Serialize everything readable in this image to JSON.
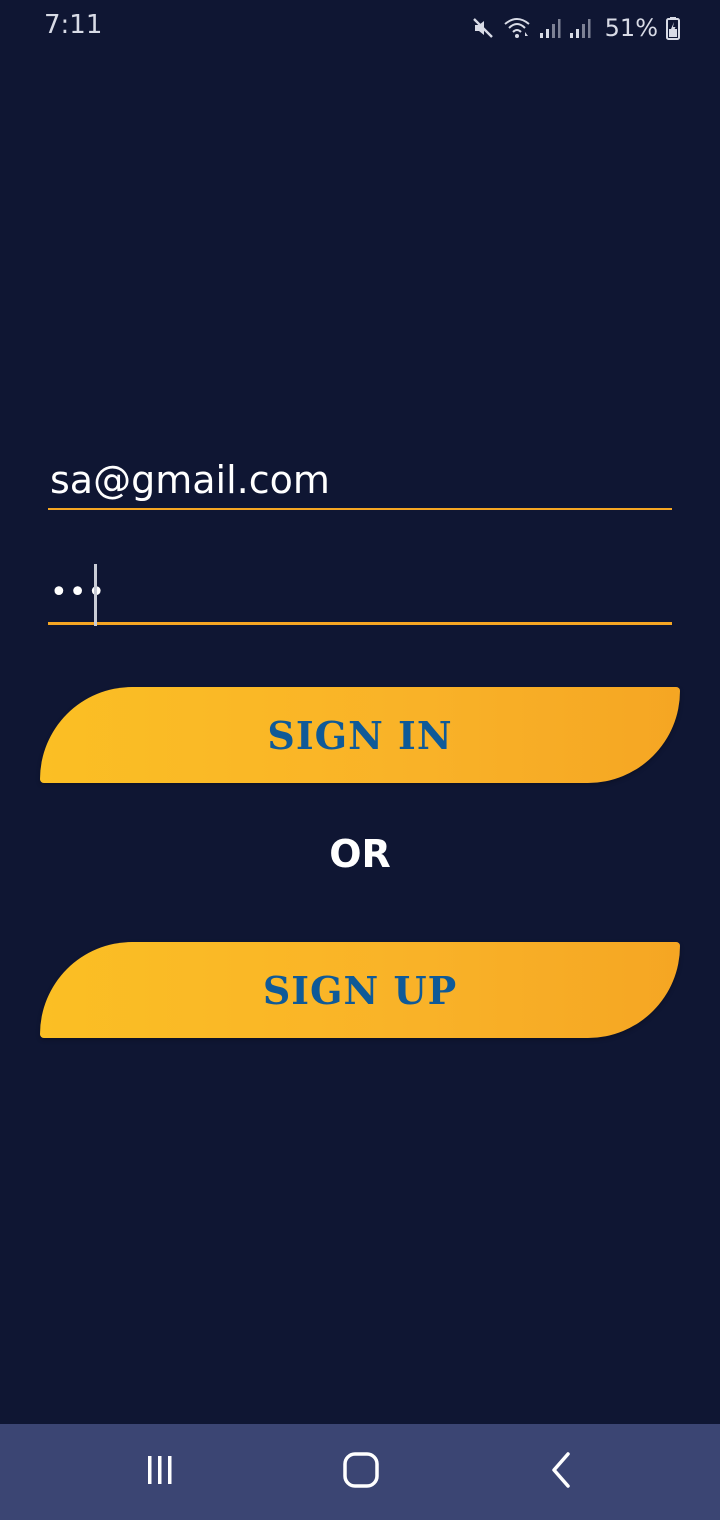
{
  "status_bar": {
    "time": "7:11",
    "battery_percent": "51%",
    "icons": [
      "mute-icon",
      "wifi-icon",
      "signal-icon",
      "signal-icon",
      "battery-icon"
    ]
  },
  "login_form": {
    "email_value": "sa@gmail.com",
    "password_value": "•••",
    "sign_in_label": "SIGN IN",
    "or_label": "OR",
    "sign_up_label": "SIGN UP"
  },
  "nav_bar": {
    "icons": [
      "recents-icon",
      "home-icon",
      "back-icon"
    ]
  },
  "colors": {
    "background": "#0f1633",
    "accent": "#f5a623",
    "button_gradient_start": "#fbbf24",
    "button_label": "#0f5a98",
    "nav_bar": "#3b4573"
  }
}
